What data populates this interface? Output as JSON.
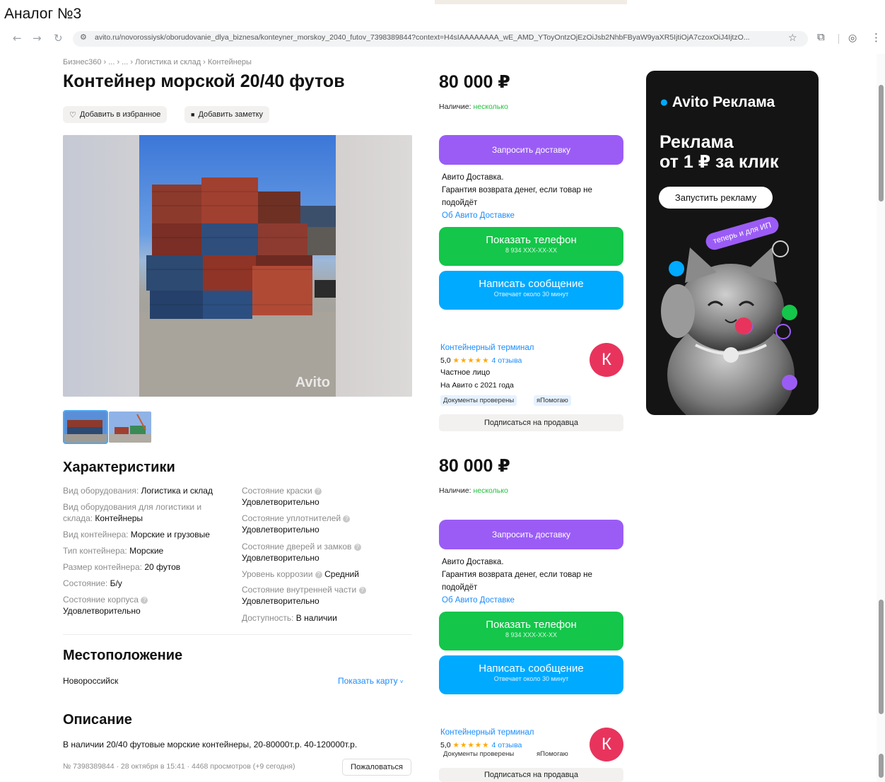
{
  "caption": "Аналог №3",
  "browser": {
    "url": "avito.ru/novorossiysk/oborudovanie_dlya_biznesa/konteyner_morskoy_2040_futov_7398389844?context=H4sIAAAAAAAA_wE_AMD_YToyOntzOjEzOiJsb2NhbFByaW9yaXR5IjtiOjA7czoxOiJ4IjtzO..."
  },
  "breadcrumb": "Бизнес360 › ... › ... › Логистика и склад › Контейнеры",
  "listing": {
    "title": "Контейнер морской 20/40 футов",
    "favorite_label": "Добавить в избранное",
    "note_label": "Добавить заметку",
    "photo_watermark": "Avito"
  },
  "specs": {
    "heading": "Характеристики",
    "left": [
      {
        "k": "Вид оборудования:",
        "v": "Логистика и склад"
      },
      {
        "k": "Вид оборудования для логистики и склада:",
        "v": "Контейнеры"
      },
      {
        "k": "Вид контейнера:",
        "v": "Морские и грузовые"
      },
      {
        "k": "Тип контейнера:",
        "v": "Морские"
      },
      {
        "k": "Размер контейнера:",
        "v": "20 футов"
      },
      {
        "k": "Состояние:",
        "v": "Б/у"
      },
      {
        "k": "Состояние корпуса",
        "v": "Удовлетворительно"
      }
    ],
    "right": [
      {
        "k": "Состояние краски",
        "v": "Удовлетворительно"
      },
      {
        "k": "Состояние уплотнителей",
        "v": "Удовлетворительно"
      },
      {
        "k": "Состояние дверей и замков",
        "v": "Удовлетворительно"
      },
      {
        "k": "Уровень коррозии",
        "v": "Средний"
      },
      {
        "k": "Состояние внутренней части",
        "v": "Удовлетворительно"
      },
      {
        "k": "Доступность:",
        "v": "В наличии"
      }
    ]
  },
  "location": {
    "heading": "Местоположение",
    "city": "Новороссийск",
    "map_link": "Показать карту"
  },
  "description": {
    "heading": "Описание",
    "text": "В наличии 20/40 футовые морские контейнеры, 20-80000т.р. 40-120000т.р.",
    "meta": "№ 7398389844 · 28 октября в 15:41 · 4468 просмотров (+9 сегодня)",
    "complain": "Пожаловаться"
  },
  "sidebar": {
    "price": "80 000 ₽",
    "availability_label": "Наличие:",
    "availability_value": "несколько",
    "delivery_btn": "Запросить доставку",
    "delivery_title": "Авито Доставка.",
    "delivery_text": "Гарантия возврата денег, если товар не подойдёт",
    "delivery_link": "Об Авито Доставке",
    "phone_btn": "Показать телефон",
    "phone_sub": "8 934 XXX-XX-XX",
    "msg_btn": "Написать сообщение",
    "msg_sub": "Отвечает около 30 минут",
    "seller_name": "Контейнерный терминал",
    "rating": "5,0",
    "stars": "★★★★★",
    "reviews": "4 отзыва",
    "seller_type": "Частное лицо",
    "seller_since": "На Авито с 2021 года",
    "badge_docs": "Документы проверены",
    "badge_help": "яПомогаю",
    "avatar_letter": "К",
    "subscribe": "Подписаться на продавца"
  },
  "ad": {
    "logo": "Avito Реклама",
    "title_line1": "Реклама",
    "title_line2": "от 1 ₽ за клик",
    "button": "Запустить рекламу",
    "tag": "теперь и для ИП"
  },
  "colors": {
    "accent_blue": "#00aaff",
    "accent_green": "#14c64a",
    "accent_purple": "#9b5cf6",
    "avatar_red": "#e8345c",
    "link_blue": "#1a8cff"
  }
}
